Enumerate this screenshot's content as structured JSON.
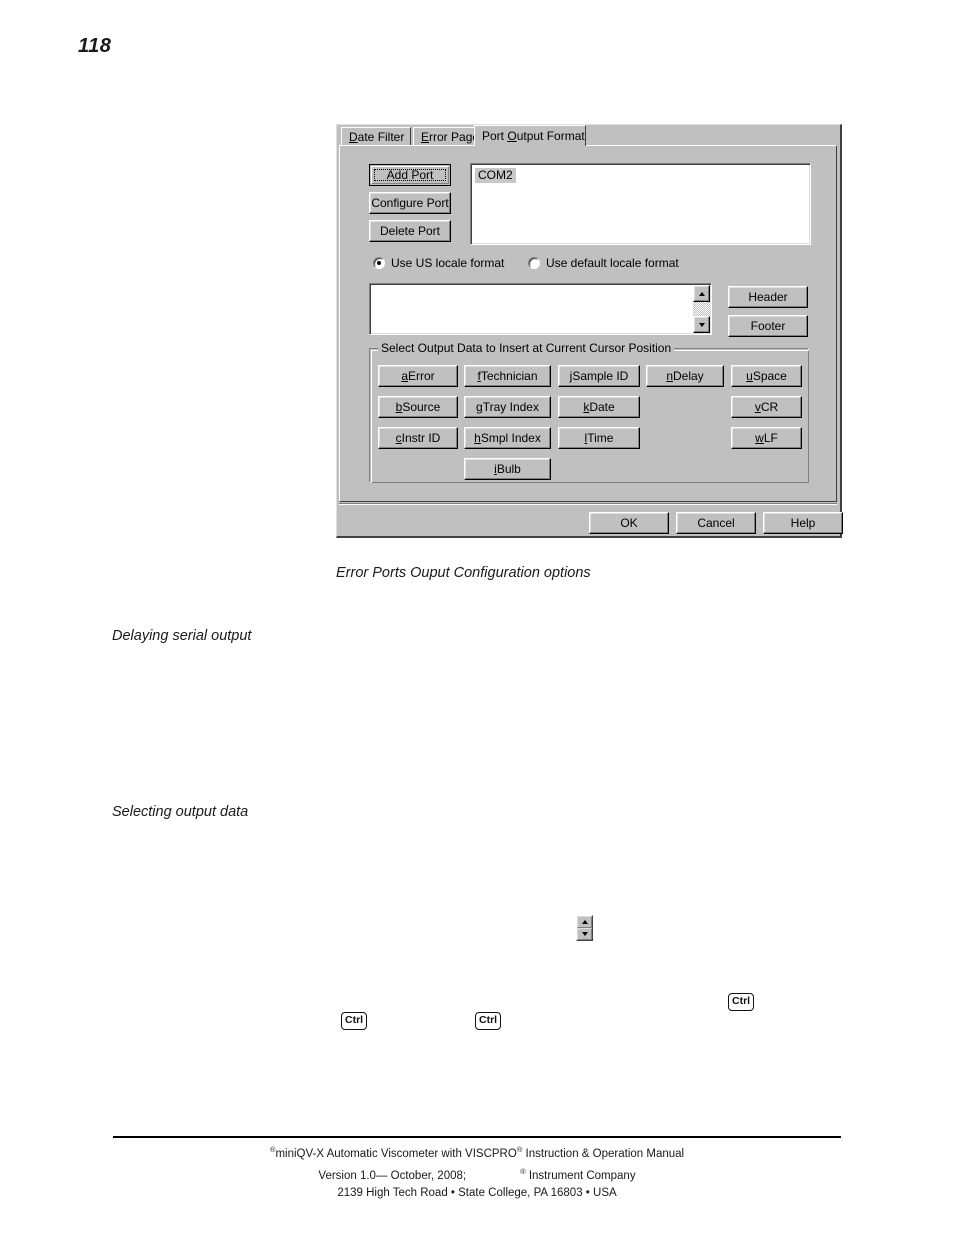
{
  "page": {
    "number": "118",
    "caption": "Error Ports Ouput Configuration options",
    "section_headings": [
      "Delaying serial output",
      "Selecting output data"
    ],
    "keycaps": [
      "Ctrl",
      "Ctrl",
      "Ctrl"
    ],
    "footer": {
      "line1_pre": "miniQV-X Automatic Viscometer with VISCPRO",
      "line1_post": "Instruction & Operation Manual",
      "line2_pre": "Version 1.0— October, 2008;",
      "line2_post": "Instrument Company",
      "line3": "2139 High Tech Road • State College, PA  16803 • USA",
      "registered_mark": "®"
    }
  },
  "dialog": {
    "tabs": [
      {
        "id": "date-filter",
        "prefix": "",
        "mnemonic": "D",
        "suffix": "ate Filter",
        "active": false
      },
      {
        "id": "error-page",
        "prefix": "",
        "mnemonic": "E",
        "suffix": "rror Page",
        "active": false
      },
      {
        "id": "port-output-format",
        "prefix": "Port ",
        "mnemonic": "O",
        "suffix": "utput Format",
        "active": true
      }
    ],
    "port_buttons": [
      {
        "id": "add-port",
        "label": "Add Port",
        "default": true
      },
      {
        "id": "configure-port",
        "label": "Configure Port",
        "default": false
      },
      {
        "id": "delete-port",
        "label": "Delete Port",
        "default": false
      }
    ],
    "port_list": {
      "items": [
        "COM2"
      ],
      "selected": "COM2"
    },
    "locale_options": [
      {
        "id": "us-locale",
        "label": "Use US locale format",
        "checked": true
      },
      {
        "id": "default-locale",
        "label": "Use default locale format",
        "checked": false
      }
    ],
    "format_textarea": {
      "value": "",
      "placeholder": ""
    },
    "side_buttons": [
      {
        "id": "header",
        "label": "Header"
      },
      {
        "id": "footer",
        "label": "Footer"
      }
    ],
    "output_group": {
      "title": "Select Output Data to Insert at Current Cursor Position",
      "buttons": [
        {
          "id": "error",
          "mnemonic": "a",
          "label": " Error",
          "col": 0,
          "row": 0
        },
        {
          "id": "source",
          "mnemonic": "b",
          "label": " Source",
          "col": 0,
          "row": 1
        },
        {
          "id": "instr-id",
          "mnemonic": "c",
          "label": " Instr ID",
          "col": 0,
          "row": 2
        },
        {
          "id": "technician",
          "mnemonic": "f",
          "label": " Technician",
          "col": 1,
          "row": 0
        },
        {
          "id": "tray-index",
          "mnemonic": "g",
          "label": " Tray Index",
          "col": 1,
          "row": 1
        },
        {
          "id": "smpl-index",
          "mnemonic": "h",
          "label": " Smpl Index",
          "col": 1,
          "row": 2
        },
        {
          "id": "bulb",
          "mnemonic": "i",
          "label": " Bulb",
          "col": 1,
          "row": 3
        },
        {
          "id": "sample-id",
          "mnemonic": "j",
          "label": " Sample ID",
          "col": 2,
          "row": 0
        },
        {
          "id": "date",
          "mnemonic": "k",
          "label": " Date",
          "col": 2,
          "row": 1
        },
        {
          "id": "time",
          "mnemonic": "l",
          "label": " Time",
          "col": 2,
          "row": 2
        },
        {
          "id": "delay",
          "mnemonic": "n",
          "label": " Delay",
          "col": 3,
          "row": 0
        },
        {
          "id": "space",
          "mnemonic": "u",
          "label": " Space",
          "col": 4,
          "row": 0
        },
        {
          "id": "cr",
          "mnemonic": "v",
          "label": " CR",
          "col": 4,
          "row": 1
        },
        {
          "id": "lf",
          "mnemonic": "w",
          "label": " LF",
          "col": 4,
          "row": 2
        }
      ]
    },
    "action_buttons": [
      {
        "id": "ok",
        "label": "OK"
      },
      {
        "id": "cancel",
        "label": "Cancel"
      },
      {
        "id": "help",
        "label": "Help"
      }
    ]
  },
  "colors": {
    "face": "#c0c0c0",
    "field": "#ffffff",
    "shadow": "#808080",
    "dark": "#404040",
    "light": "#dfdfdf",
    "highlight": "#c8c8c8",
    "text": "#000000"
  }
}
